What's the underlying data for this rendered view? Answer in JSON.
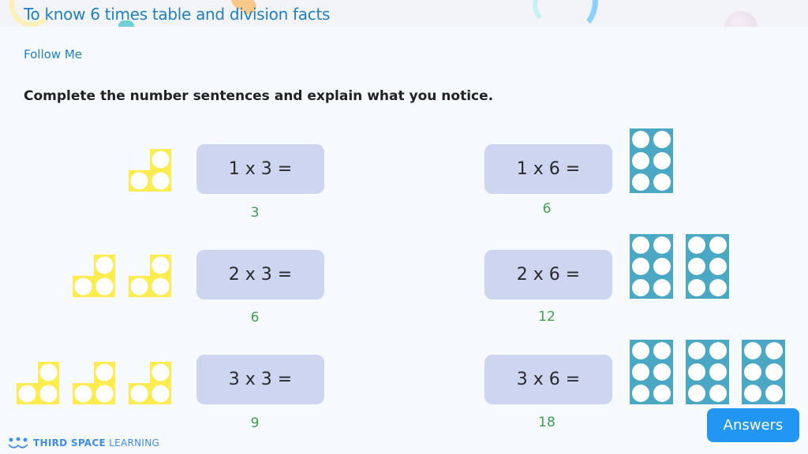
{
  "header": {
    "title": "To know 6 times table and division facts"
  },
  "subtitle": "Follow Me",
  "instruction": "Complete the number sentences and explain what you notice.",
  "colors": {
    "title": "#1f7fc4",
    "equation_box": "#cdd5f1",
    "answer_text": "#3fa04a",
    "numicon_three": "#fdec4f",
    "numicon_six": "#4aa8c4",
    "answers_button": "#2196f3"
  },
  "left_column": [
    {
      "equation": "1 x 3 =",
      "answer": "3",
      "numicon_count": 1,
      "numicon_value": 3
    },
    {
      "equation": "2 x 3 =",
      "answer": "6",
      "numicon_count": 2,
      "numicon_value": 3
    },
    {
      "equation": "3 x 3 =",
      "answer": "9",
      "numicon_count": 3,
      "numicon_value": 3
    }
  ],
  "right_column": [
    {
      "equation": "1 x 6 =",
      "answer": "6",
      "numicon_count": 1,
      "numicon_value": 6
    },
    {
      "equation": "2 x 6 =",
      "answer": "12",
      "numicon_count": 2,
      "numicon_value": 6
    },
    {
      "equation": "3 x 6 =",
      "answer": "18",
      "numicon_count": 3,
      "numicon_value": 6
    }
  ],
  "footer": {
    "logo_icon": "third-space-learning-logo-icon",
    "logo_bold": "THIRD SPACE",
    "logo_light": "LEARNING",
    "answers_button": "Answers"
  }
}
